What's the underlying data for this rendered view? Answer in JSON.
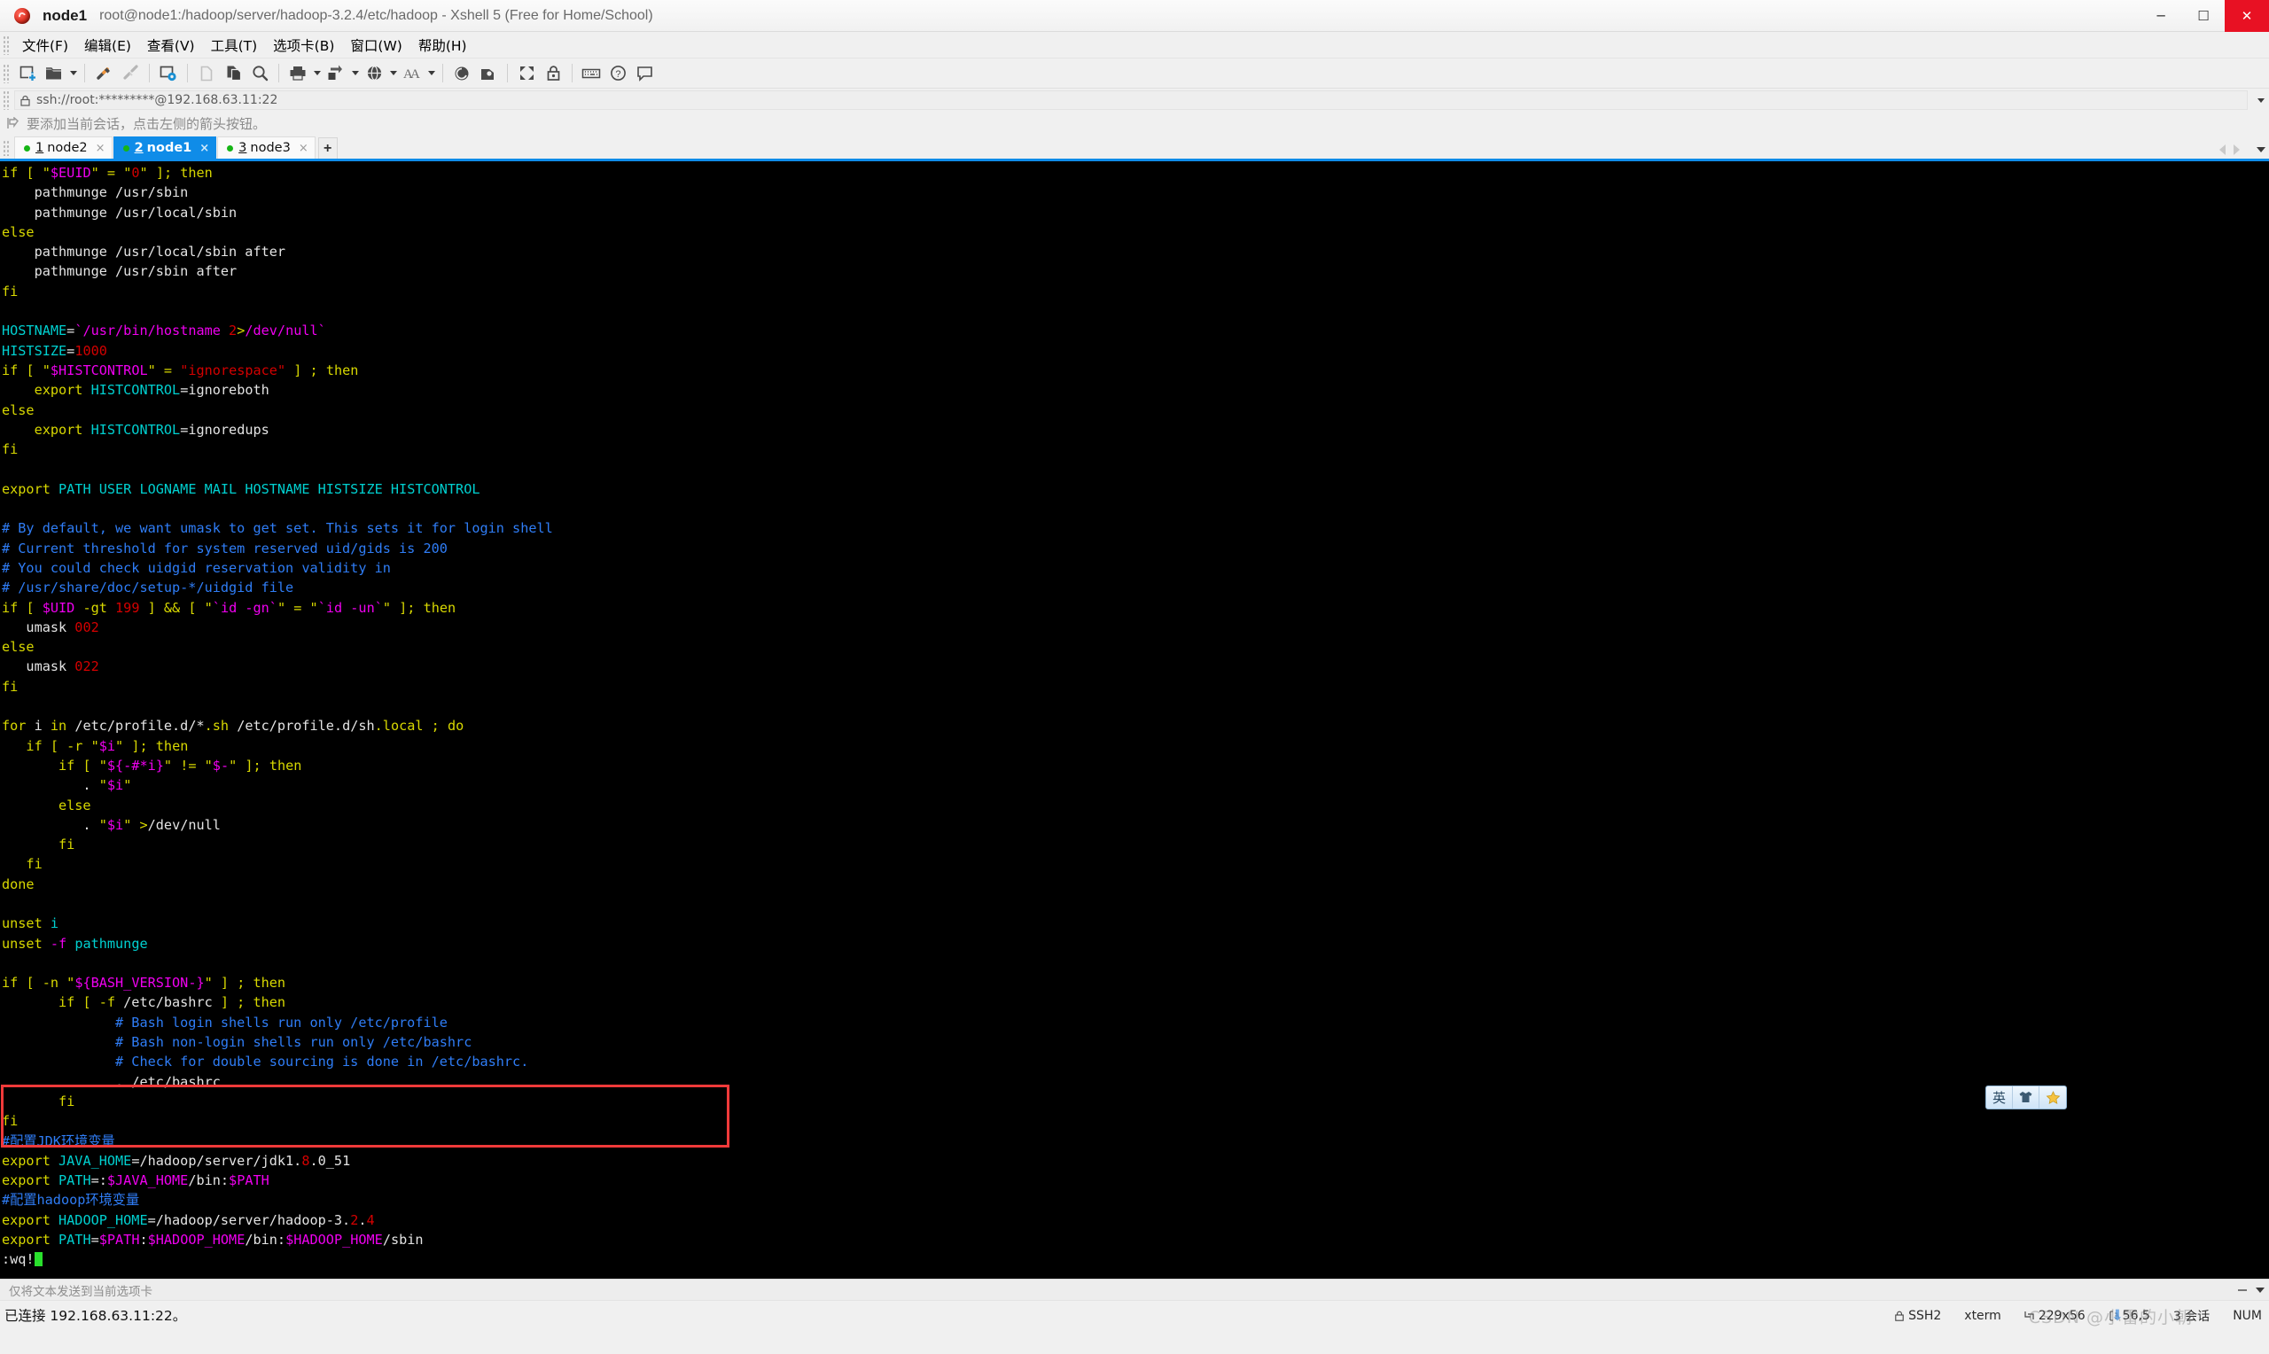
{
  "window": {
    "app_icon": "xshell-icon",
    "host": "node1",
    "path_title": "root@node1:/hadoop/server/hadoop-3.2.4/etc/hadoop - Xshell 5 (Free for Home/School)",
    "minimize": "─",
    "maximize": "☐",
    "close": "✕"
  },
  "menu": {
    "items": [
      {
        "label": "文件(F)",
        "name": "menu-file"
      },
      {
        "label": "编辑(E)",
        "name": "menu-edit"
      },
      {
        "label": "查看(V)",
        "name": "menu-view"
      },
      {
        "label": "工具(T)",
        "name": "menu-tools"
      },
      {
        "label": "选项卡(B)",
        "name": "menu-tabs"
      },
      {
        "label": "窗口(W)",
        "name": "menu-window"
      },
      {
        "label": "帮助(H)",
        "name": "menu-help"
      }
    ]
  },
  "toolbar": {
    "icons": [
      "new-session-icon",
      "open-folder-icon",
      "connect-icon",
      "disconnect-icon",
      "session-properties-icon",
      "copy-icon",
      "paste-icon",
      "find-icon",
      "print-icon",
      "transfer-icon",
      "globe-icon",
      "font-icon",
      "xftp-icon",
      "xagent-icon",
      "fullscreen-icon",
      "lock-icon",
      "keyboard-icon",
      "help-icon",
      "comment-icon"
    ]
  },
  "address": {
    "lock_icon": "lock-icon",
    "value": "ssh://root:*********@192.168.63.11:22",
    "dropdown_icon": "chevron-down-icon"
  },
  "hint": {
    "icon": "add-to-favorites-icon",
    "text": "要添加当前会话，点击左侧的箭头按钮。"
  },
  "tabs": {
    "items": [
      {
        "num": "1",
        "label": "node2",
        "active": false,
        "status_color": "#16b516",
        "close": "×"
      },
      {
        "num": "2",
        "label": "node1",
        "active": true,
        "status_color": "#16b516",
        "close": "×"
      },
      {
        "num": "3",
        "label": "node3",
        "active": false,
        "status_color": "#16b516",
        "close": "×"
      }
    ],
    "add_label": "+",
    "scroll_left_icon": "triangle-left-icon",
    "scroll_right_icon": "triangle-right-icon",
    "tab_list_icon": "chevron-down-icon",
    "active_accent": "#0f8ce8"
  },
  "terminal": {
    "colors": {
      "background": "#000000",
      "foreground": "#d6d6d6",
      "keyword": "#d8d800",
      "variable": "#f000f0",
      "string": "#d40000",
      "identifier": "#00d0d0",
      "comment": "#2f7df6",
      "cursor": "#29e02c",
      "highlight_box": "#f03a3a"
    },
    "cursor_text": ":wq!",
    "lines": [
      [
        [
          "if ",
          "kw"
        ],
        [
          "[ ",
          "kw"
        ],
        [
          "\"",
          "kw"
        ],
        [
          "$EUID",
          "var"
        ],
        [
          "\"",
          "kw"
        ],
        [
          " = ",
          "kw"
        ],
        [
          "\"",
          "kw"
        ],
        [
          "0",
          "str"
        ],
        [
          "\"",
          "kw"
        ],
        [
          " ]; ",
          "kw"
        ],
        [
          "then",
          "kw"
        ]
      ],
      [
        [
          "    pathmunge /usr/sbin",
          "wht"
        ]
      ],
      [
        [
          "    pathmunge /usr/local/sbin",
          "wht"
        ]
      ],
      [
        [
          "else",
          "kw"
        ]
      ],
      [
        [
          "    pathmunge /usr/local/sbin after",
          "wht"
        ]
      ],
      [
        [
          "    pathmunge /usr/sbin after",
          "wht"
        ]
      ],
      [
        [
          "fi",
          "kw"
        ]
      ],
      [
        [
          "",
          "wht"
        ]
      ],
      [
        [
          "HOSTNAME",
          "cyan"
        ],
        [
          "=",
          "wht"
        ],
        [
          "`/usr/bin/hostname ",
          "var"
        ],
        [
          "2",
          "str"
        ],
        [
          ">",
          "kw"
        ],
        [
          "/dev/null`",
          "var"
        ]
      ],
      [
        [
          "HISTSIZE",
          "cyan"
        ],
        [
          "=",
          "wht"
        ],
        [
          "1000",
          "str"
        ]
      ],
      [
        [
          "if ",
          "kw"
        ],
        [
          "[ ",
          "kw"
        ],
        [
          "\"",
          "kw"
        ],
        [
          "$HISTCONTROL",
          "var"
        ],
        [
          "\"",
          "kw"
        ],
        [
          " = ",
          "kw"
        ],
        [
          "\"ignorespace\"",
          "str"
        ],
        [
          " ] ; ",
          "kw"
        ],
        [
          "then",
          "kw"
        ]
      ],
      [
        [
          "    export ",
          "kw"
        ],
        [
          "HISTCONTROL",
          "cyan"
        ],
        [
          "=ignoreboth",
          "wht"
        ]
      ],
      [
        [
          "else",
          "kw"
        ]
      ],
      [
        [
          "    export ",
          "kw"
        ],
        [
          "HISTCONTROL",
          "cyan"
        ],
        [
          "=ignoredups",
          "wht"
        ]
      ],
      [
        [
          "fi",
          "kw"
        ]
      ],
      [
        [
          "",
          "wht"
        ]
      ],
      [
        [
          "export ",
          "kw"
        ],
        [
          "PATH USER LOGNAME MAIL HOSTNAME HISTSIZE HISTCONTROL",
          "cyan"
        ]
      ],
      [
        [
          "",
          "wht"
        ]
      ],
      [
        [
          "# By default, we want umask to get set. This sets it for login shell",
          "cmt"
        ]
      ],
      [
        [
          "# Current threshold for system reserved uid/gids is 200",
          "cmt"
        ]
      ],
      [
        [
          "# You could check uidgid reservation validity in",
          "cmt"
        ]
      ],
      [
        [
          "# /usr/share/doc/setup-*/uidgid file",
          "cmt"
        ]
      ],
      [
        [
          "if ",
          "kw"
        ],
        [
          "[ ",
          "kw"
        ],
        [
          "$UID",
          "var"
        ],
        [
          " -gt ",
          "kw"
        ],
        [
          "199",
          "str"
        ],
        [
          " ] ",
          "kw"
        ],
        [
          "&& ",
          "kw"
        ],
        [
          "[ ",
          "kw"
        ],
        [
          "\"",
          "kw"
        ],
        [
          "`id -gn`",
          "var"
        ],
        [
          "\"",
          "kw"
        ],
        [
          " = ",
          "kw"
        ],
        [
          "\"",
          "kw"
        ],
        [
          "`id -un`",
          "var"
        ],
        [
          "\"",
          "kw"
        ],
        [
          " ]; ",
          "kw"
        ],
        [
          "then",
          "kw"
        ]
      ],
      [
        [
          "   umask ",
          "wht"
        ],
        [
          "002",
          "str"
        ]
      ],
      [
        [
          "else",
          "kw"
        ]
      ],
      [
        [
          "   umask ",
          "wht"
        ],
        [
          "022",
          "str"
        ]
      ],
      [
        [
          "fi",
          "kw"
        ]
      ],
      [
        [
          "",
          "wht"
        ]
      ],
      [
        [
          "for ",
          "kw"
        ],
        [
          "i ",
          "wht"
        ],
        [
          "in ",
          "kw"
        ],
        [
          "/etc/profile.d/*",
          "wht"
        ],
        [
          ".sh",
          "kw"
        ],
        [
          " /etc/profile.d/sh",
          "wht"
        ],
        [
          ".local",
          "kw"
        ],
        [
          " ; ",
          "kw"
        ],
        [
          "do",
          "kw"
        ]
      ],
      [
        [
          "   if ",
          "kw"
        ],
        [
          "[ -r ",
          "kw"
        ],
        [
          "\"",
          "kw"
        ],
        [
          "$i",
          "var"
        ],
        [
          "\"",
          "kw"
        ],
        [
          " ]; ",
          "kw"
        ],
        [
          "then",
          "kw"
        ]
      ],
      [
        [
          "       if ",
          "kw"
        ],
        [
          "[ ",
          "kw"
        ],
        [
          "\"",
          "kw"
        ],
        [
          "${-#*i}",
          "var"
        ],
        [
          "\"",
          "kw"
        ],
        [
          " != ",
          "kw"
        ],
        [
          "\"",
          "kw"
        ],
        [
          "$-",
          "var"
        ],
        [
          "\"",
          "kw"
        ],
        [
          " ]; ",
          "kw"
        ],
        [
          "then",
          "kw"
        ]
      ],
      [
        [
          "          . ",
          "wht"
        ],
        [
          "\"",
          "kw"
        ],
        [
          "$i",
          "var"
        ],
        [
          "\"",
          "kw"
        ]
      ],
      [
        [
          "       else",
          "kw"
        ]
      ],
      [
        [
          "          . ",
          "wht"
        ],
        [
          "\"",
          "kw"
        ],
        [
          "$i",
          "var"
        ],
        [
          "\"",
          "kw"
        ],
        [
          " >",
          "kw"
        ],
        [
          "/dev/null",
          "wht"
        ]
      ],
      [
        [
          "       fi",
          "kw"
        ]
      ],
      [
        [
          "   fi",
          "kw"
        ]
      ],
      [
        [
          "done",
          "kw"
        ]
      ],
      [
        [
          "",
          "wht"
        ]
      ],
      [
        [
          "unset ",
          "kw"
        ],
        [
          "i",
          "cyan"
        ]
      ],
      [
        [
          "unset ",
          "kw"
        ],
        [
          "-f ",
          "var"
        ],
        [
          "pathmunge",
          "cyan"
        ]
      ],
      [
        [
          "",
          "wht"
        ]
      ],
      [
        [
          "if ",
          "kw"
        ],
        [
          "[ -n ",
          "kw"
        ],
        [
          "\"",
          "kw"
        ],
        [
          "${BASH_VERSION-}",
          "var"
        ],
        [
          "\"",
          "kw"
        ],
        [
          " ] ; ",
          "kw"
        ],
        [
          "then",
          "kw"
        ]
      ],
      [
        [
          "       if ",
          "kw"
        ],
        [
          "[ -f ",
          "kw"
        ],
        [
          "/etc/bashrc",
          "wht"
        ],
        [
          " ] ; ",
          "kw"
        ],
        [
          "then",
          "kw"
        ]
      ],
      [
        [
          "              # Bash login shells run only /etc/profile",
          "cmt"
        ]
      ],
      [
        [
          "              # Bash non-login shells run only /etc/bashrc",
          "cmt"
        ]
      ],
      [
        [
          "              # Check for double sourcing is done in /etc/bashrc.",
          "cmt"
        ]
      ],
      [
        [
          "              . ",
          "wht"
        ],
        [
          "/etc/bashrc",
          "wht"
        ]
      ],
      [
        [
          "       fi",
          "kw"
        ]
      ],
      [
        [
          "fi",
          "kw"
        ]
      ],
      [
        [
          "#配置JDK环境变量",
          "cmt"
        ]
      ],
      [
        [
          "export ",
          "kw"
        ],
        [
          "JAVA_HOME",
          "cyan"
        ],
        [
          "=/hadoop/server/jdk1.",
          "wht"
        ],
        [
          "8",
          "str"
        ],
        [
          ".0_51",
          "wht"
        ]
      ],
      [
        [
          "export ",
          "kw"
        ],
        [
          "PATH",
          "cyan"
        ],
        [
          "=:",
          "wht"
        ],
        [
          "$JAVA_HOME",
          "var"
        ],
        [
          "/bin:",
          "wht"
        ],
        [
          "$PATH",
          "var"
        ]
      ],
      [
        [
          "#配置hadoop环境变量",
          "cmt"
        ]
      ],
      [
        [
          "export ",
          "kw"
        ],
        [
          "HADOOP_HOME",
          "cyan"
        ],
        [
          "=/hadoop/server/hadoop-3.",
          "wht"
        ],
        [
          "2",
          "str"
        ],
        [
          ".",
          "wht"
        ],
        [
          "4",
          "str"
        ]
      ],
      [
        [
          "export ",
          "kw"
        ],
        [
          "PATH",
          "cyan"
        ],
        [
          "=",
          "wht"
        ],
        [
          "$PATH",
          "var"
        ],
        [
          ":",
          "wht"
        ],
        [
          "$HADOOP_HOME",
          "var"
        ],
        [
          "/bin:",
          "wht"
        ],
        [
          "$HADOOP_HOME",
          "var"
        ],
        [
          "/sbin",
          "wht"
        ]
      ]
    ]
  },
  "ime": {
    "mode_label": "英",
    "skin_icon": "skin-icon",
    "star_icon": "star-icon"
  },
  "sendbar": {
    "text": "仅将文本发送到当前选项卡",
    "collapse_icon": "minus-icon",
    "dropdown_icon": "chevron-down-icon"
  },
  "statusbar": {
    "connection": "已连接 192.168.63.11:22。",
    "protocol": "SSH2",
    "protocol_icon": "lock-icon",
    "terminal_type": "xterm",
    "size": "229x56",
    "size_icon": "resize-icon",
    "cursor_pos": "56,5",
    "cursor_icon": "cursor-icon",
    "sessions": "3 会话",
    "num_lock": "NUM"
  },
  "watermark": {
    "text": "CSDN @小雷的小朝",
    "arrow_icon": "download-arrow-icon"
  }
}
